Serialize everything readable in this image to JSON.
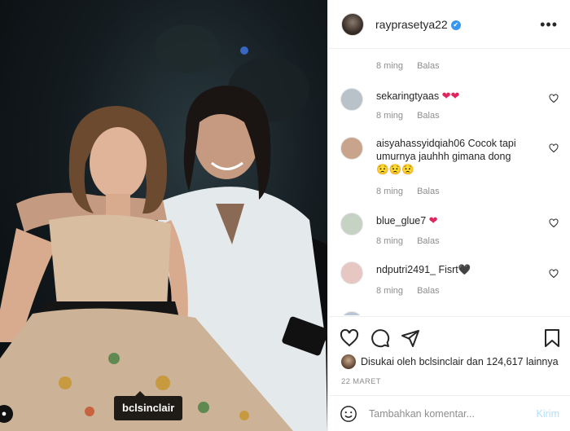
{
  "post": {
    "tag_username": "bclsinclair"
  },
  "header": {
    "username": "rayprasetya22",
    "verified_glyph": "✔",
    "more_glyph": "•••"
  },
  "comments": {
    "top_meta": {
      "time": "8 ming",
      "reply": "Balas"
    },
    "items": [
      {
        "username": "sekaringtyaas",
        "text": "",
        "hearts": "❤❤",
        "time": "8 ming",
        "reply": "Balas",
        "avatar_color": "#b9c2c8"
      },
      {
        "username": "aisyahassyidqiah06",
        "text": "Cocok tapi umurnya jauhhh gimana dong",
        "hearts": "😟😟😟",
        "time": "8 ming",
        "reply": "Balas",
        "avatar_color": "#c8a48c"
      },
      {
        "username": "blue_glue7",
        "text": "",
        "hearts": "❤",
        "time": "8 ming",
        "reply": "Balas",
        "avatar_color": "#c6d2c4"
      },
      {
        "username": "ndputri2491_",
        "text": "Fisrt🖤",
        "hearts": "",
        "time": "8 ming",
        "reply": "Balas",
        "avatar_color": "#e6c7c2"
      }
    ]
  },
  "actions": {
    "liked_prefix": "Disukai oleh",
    "liked_user": "bclsinclair",
    "liked_connector": "dan",
    "liked_count": "124,617",
    "liked_suffix": "lainnya",
    "date": "22 MARET"
  },
  "add_comment": {
    "placeholder": "Tambahkan komentar...",
    "post_label": "Kirim"
  },
  "colors": {
    "accent": "#3897f0",
    "heart": "#e0245e",
    "post_disabled": "#b2dffc",
    "muted": "#8e8e8e"
  }
}
